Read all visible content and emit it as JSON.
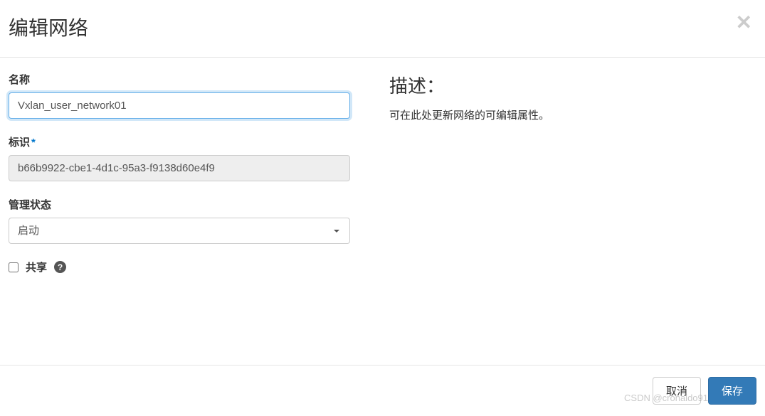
{
  "modal": {
    "title": "编辑网络"
  },
  "form": {
    "name_label": "名称",
    "name_value": "Vxlan_user_network01",
    "id_label": "标识",
    "id_value": "b66b9922-cbe1-4d1c-95a3-f9138d60e4f9",
    "admin_state_label": "管理状态",
    "admin_state_value": "启动",
    "share_label": "共享",
    "share_checked": false
  },
  "description": {
    "title": "描述：",
    "text": "可在此处更新网络的可编辑属性。"
  },
  "footer": {
    "cancel_label": "取消",
    "save_label": "保存"
  },
  "watermark": "CSDN @cronaldo91"
}
